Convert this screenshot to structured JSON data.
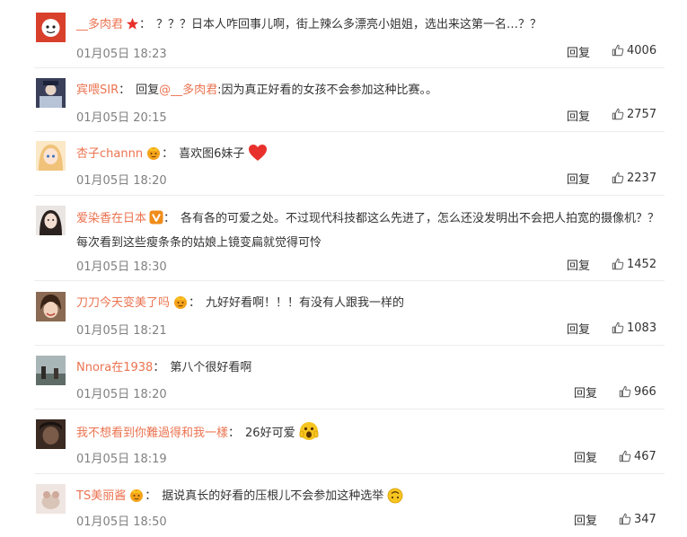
{
  "reply_label": "回复",
  "comments": [
    {
      "user": "__多肉君",
      "badge": "star",
      "text": "？？？日本人咋回事儿啊，街上辣么多漂亮小姐姐，选出来这第一名…？？",
      "time": "01月05日 18:23",
      "likes": "4006",
      "avatar_bg": "#d8402c"
    },
    {
      "user": "宾喂SIR",
      "badge": "",
      "reply_prefix": "回复",
      "mention": "@__多肉君",
      "text": ":因为真正好看的女孩不会参加这种比赛。。",
      "time": "01月05日 20:15",
      "likes": "2757",
      "avatar_bg": "#3a3f5a"
    },
    {
      "user": "杏子channn",
      "badge": "crown",
      "text": "喜欢图6妹子",
      "inline_emoji": "heart",
      "time": "01月05日 18:20",
      "likes": "2237",
      "avatar_bg": "#f0c27a"
    },
    {
      "user": "爱染香在日本",
      "badge": "v",
      "text": "各有各的可爱之处。不过现代科技都这么先进了，怎么还没发明出不会把人拍宽的摄像机？？每次看到这些瘦条条的姑娘上镜变扁就觉得可怜",
      "time": "01月05日 18:30",
      "likes": "1452",
      "avatar_bg": "#5a4a44"
    },
    {
      "user": "刀刀今天变美了吗",
      "badge": "crown",
      "text": "九好好看啊！！！有没有人跟我一样的",
      "time": "01月05日 18:21",
      "likes": "1083",
      "avatar_bg": "#6b4a3a"
    },
    {
      "user": "Nnora在1938",
      "badge": "",
      "text": "第八个很好看啊",
      "time": "01月05日 18:20",
      "likes": "966",
      "avatar_bg": "#7a8a8c"
    },
    {
      "user": "我不想看到你難過得和我一樣",
      "badge": "",
      "text": "26好可爱",
      "inline_emoji": "surprised-face",
      "time": "01月05日 18:19",
      "likes": "467",
      "avatar_bg": "#3a2a22"
    },
    {
      "user": "TS美丽酱",
      "badge": "crown",
      "text": "据说真长的好看的压根儿不会参加这种选举",
      "inline_emoji": "upside-down-face",
      "time": "01月05日 18:50",
      "likes": "347",
      "avatar_bg": "#d9c4b8"
    }
  ]
}
